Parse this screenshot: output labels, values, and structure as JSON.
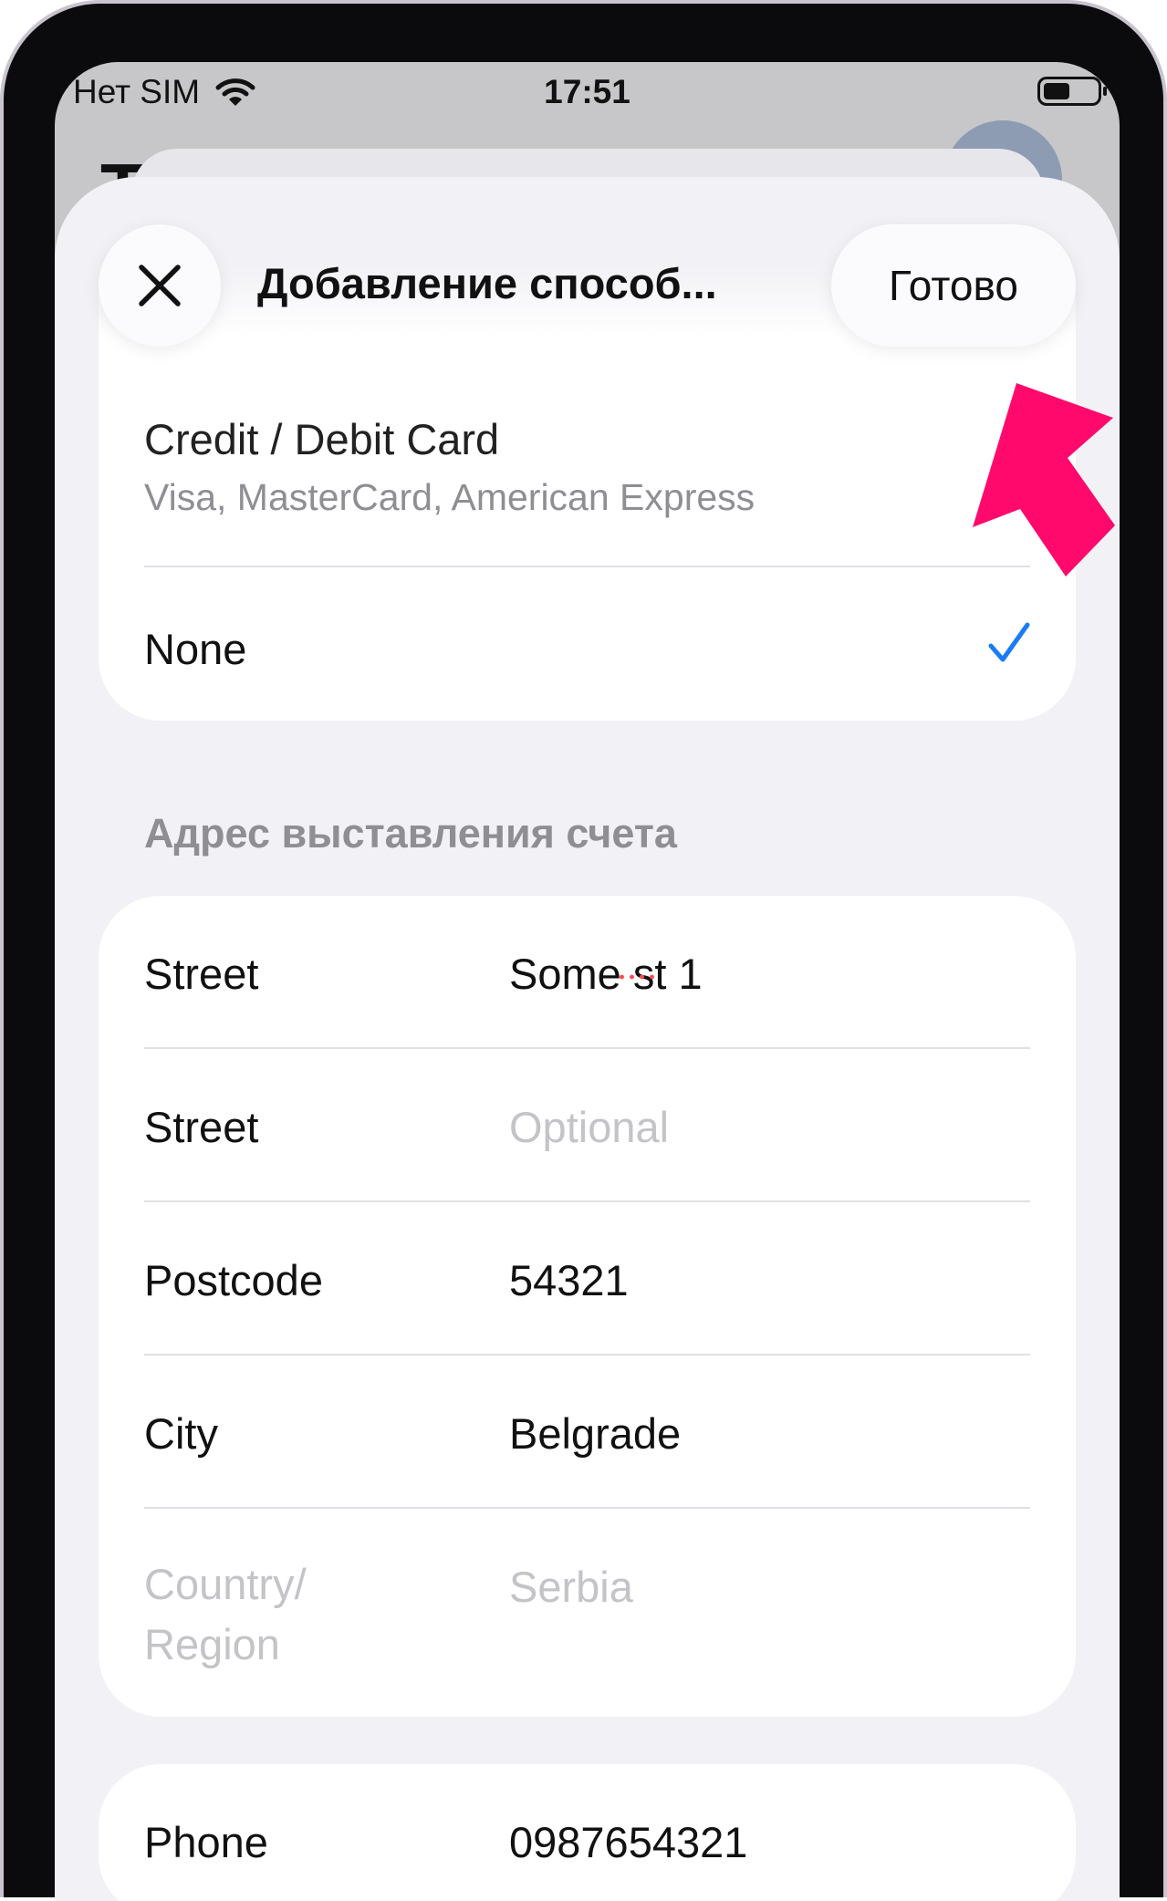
{
  "status_bar": {
    "carrier": "Нет SIM",
    "time": "17:51"
  },
  "background": {
    "title_letter": "T"
  },
  "header": {
    "title": "Добавление способ...",
    "done_label": "Готово"
  },
  "payment": {
    "option_title": "Credit / Debit Card",
    "option_subtitle": "Visa, MasterCard, American Express",
    "selected_option": "None"
  },
  "billing_section_title": "Адрес выставления счета",
  "billing_fields": [
    {
      "label": "Street",
      "value": "Some st 1",
      "placeholder": ""
    },
    {
      "label": "Street",
      "value": "",
      "placeholder": "Optional"
    },
    {
      "label": "Postcode",
      "value": "54321",
      "placeholder": ""
    },
    {
      "label": "City",
      "value": "Belgrade",
      "placeholder": ""
    },
    {
      "label": "Country/ Region",
      "value": "Serbia",
      "placeholder": ""
    }
  ],
  "phone": {
    "label": "Phone",
    "value": "0987654321"
  },
  "colors": {
    "accent_check": "#1a7cf5",
    "arrow": "#ff0a6c",
    "sheet_bg": "#f1f1f6"
  },
  "icons": {
    "close": "close-icon",
    "check": "checkmark-icon",
    "wifi": "wifi-icon",
    "battery": "battery-icon",
    "arrow": "pointer-arrow-icon"
  }
}
